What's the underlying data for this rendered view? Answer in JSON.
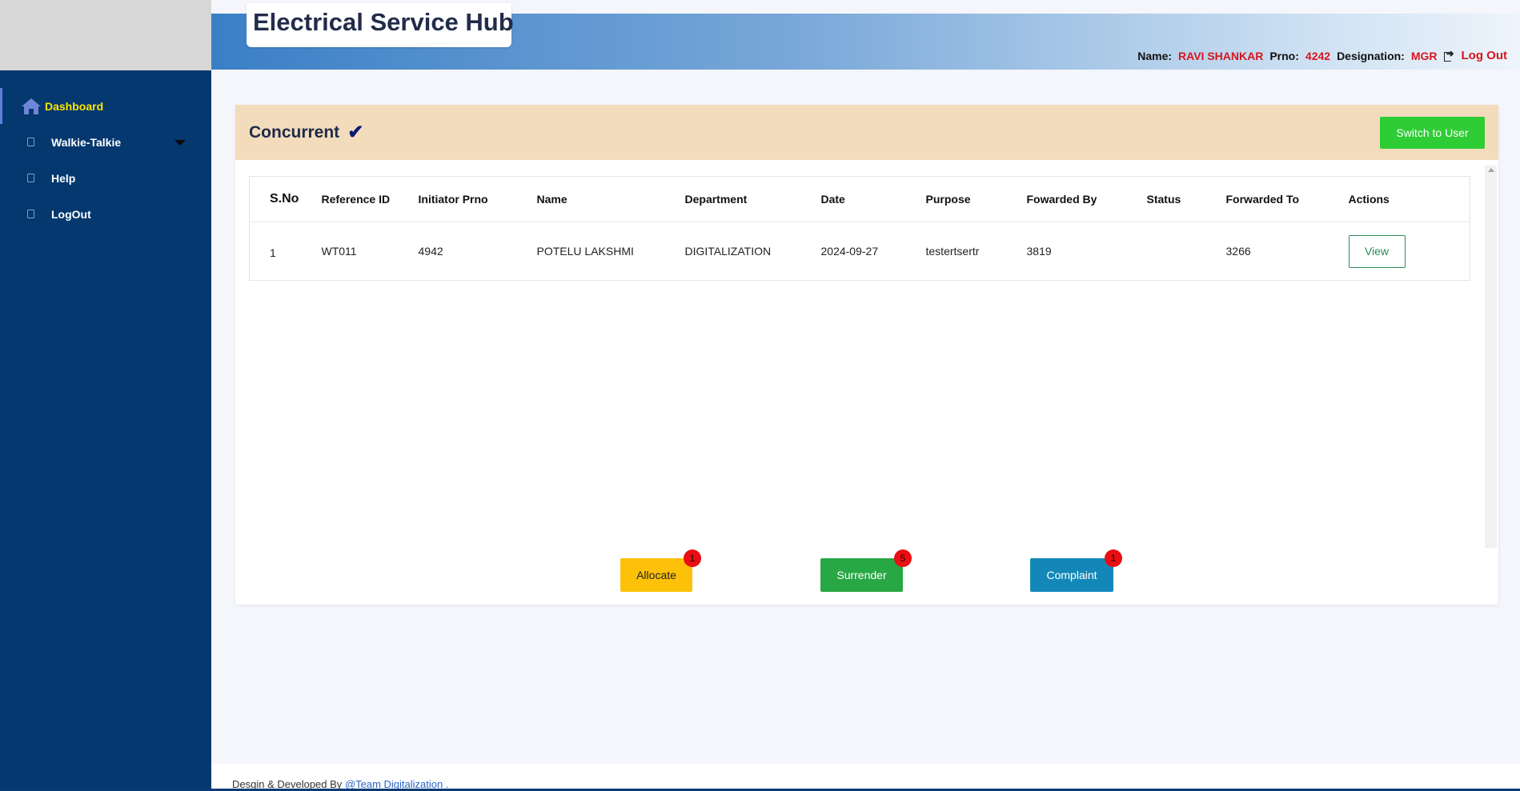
{
  "app": {
    "title": "Electrical Service Hub"
  },
  "header": {
    "name_label": "Name:",
    "name_value": "RAVI SHANKAR",
    "prno_label": "Prno:",
    "prno_value": "4242",
    "designation_label": "Designation:",
    "designation_value": "MGR",
    "logout_label": "Log Out"
  },
  "sidebar": {
    "items": [
      {
        "label": "Dashboard",
        "icon": "home-icon",
        "active": true
      },
      {
        "label": "Walkie-Talkie",
        "icon": "square-icon",
        "has_caret": true
      },
      {
        "label": "Help",
        "icon": "square-icon"
      },
      {
        "label": "LogOut",
        "icon": "square-icon"
      }
    ]
  },
  "card": {
    "title": "Concurrent",
    "switch_label": "Switch to User"
  },
  "table": {
    "columns": [
      "S.No",
      "Reference ID",
      "Initiator Prno",
      "Name",
      "Department",
      "Date",
      "Purpose",
      "Fowarded By",
      "Status",
      "Forwarded To",
      "Actions"
    ],
    "rows": [
      {
        "sno": "1",
        "reference_id": "WT011",
        "initiator_prno": "4942",
        "name": "POTELU LAKSHMI",
        "department": "DIGITALIZATION",
        "date": "2024-09-27",
        "purpose": "testertsertr",
        "forwarded_by": "3819",
        "status": "",
        "forwarded_to": "3266",
        "action_label": "View"
      }
    ]
  },
  "actions": {
    "allocate": {
      "label": "Allocate",
      "count": "1"
    },
    "surrender": {
      "label": "Surrender",
      "count": "5"
    },
    "complaint": {
      "label": "Complaint",
      "count": "1"
    }
  },
  "footer": {
    "text": "Desgin & Developed By",
    "link": "@Team Digitalization",
    "suffix": "."
  },
  "colors": {
    "sidebar_bg": "#04386f",
    "header_accent": "#d9151c",
    "card_head_bg": "#f3dcbc",
    "switch_btn": "#2ecc35",
    "allocate_btn": "#fdc10a",
    "surrender_btn": "#28a745",
    "complaint_btn": "#1388b8"
  }
}
